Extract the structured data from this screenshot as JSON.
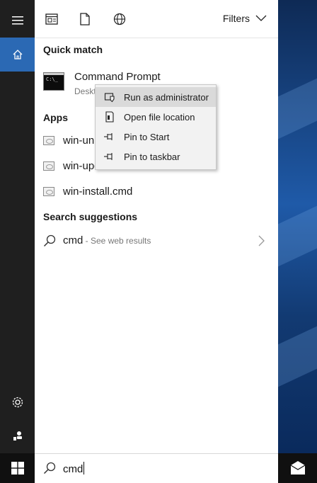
{
  "topbar": {
    "filters_label": "Filters"
  },
  "sections": {
    "quick_match": "Quick match",
    "apps": "Apps",
    "search_suggestions": "Search suggestions"
  },
  "best_match": {
    "title": "Command Prompt",
    "subtitle": "Desktop app",
    "subtitle_visible": "Deskt"
  },
  "apps": [
    {
      "label": "win-un"
    },
    {
      "label": "win-update-tools.cmd"
    },
    {
      "label": "win-install.cmd"
    }
  ],
  "suggestion": {
    "query": "cmd",
    "suffix": " - See web results"
  },
  "context_menu": [
    {
      "label": "Run as administrator",
      "icon": "shield-icon"
    },
    {
      "label": "Open file location",
      "icon": "file-location-icon"
    },
    {
      "label": "Pin to Start",
      "icon": "pin-icon"
    },
    {
      "label": "Pin to taskbar",
      "icon": "pin-icon"
    }
  ],
  "search": {
    "query": "cmd"
  },
  "colors": {
    "accent": "#2b69b4",
    "rail": "#1f1f1f",
    "taskbar": "#101010"
  }
}
